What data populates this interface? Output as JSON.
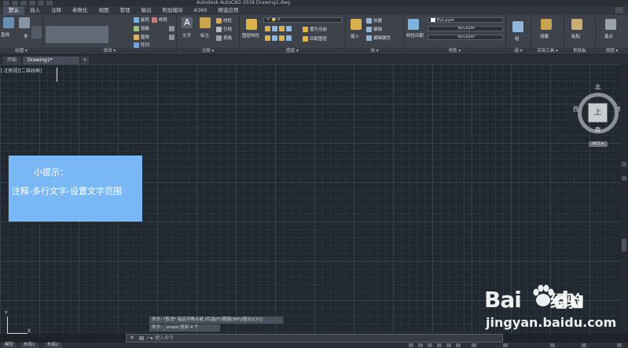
{
  "window": {
    "title": "Autodesk AutoCAD 2018   Drawing1.dwg"
  },
  "ribbon_tabs": [
    "默认",
    "插入",
    "注释",
    "参数化",
    "视图",
    "管理",
    "输出",
    "附加模块",
    "A360",
    "精选应用"
  ],
  "ribbon": {
    "draw": {
      "line_label": "直线",
      "multi_label": "多",
      "footer": "绘图 ▾"
    },
    "modify": {
      "rotate": "旋转",
      "trim": "修剪",
      "mirror": "镜像",
      "fillet": "圆角",
      "array": "阵列",
      "footer": "修改 ▾"
    },
    "annotation": {
      "text": "文字",
      "dimension": "标注",
      "linear": "线性",
      "leader": "引线",
      "table": "表格",
      "footer": "注释 ▾"
    },
    "layers": {
      "layer_props": "图层特性",
      "layer_value": "0",
      "set_current": "置为当前",
      "match_layer": "匹配图层",
      "footer": "图层 ▾"
    },
    "block": {
      "insert": "插入",
      "create": "创建",
      "edit": "编辑",
      "edit_attr": "编辑属性",
      "footer": "块 ▾"
    },
    "properties": {
      "match": "特性匹配",
      "bylayer1": "ByLayer",
      "bylayer2": "ByLayer",
      "bylayer3": "ByLayer",
      "footer": "特性 ▾"
    },
    "groups": {
      "label": "组",
      "footer": "组 ▾"
    },
    "utilities": {
      "measure": "测量",
      "footer": "实用工具 ▾"
    },
    "clipboard": {
      "paste": "粘贴",
      "footer": "剪贴板"
    },
    "view": {
      "base": "基点",
      "footer": "视图 ▾"
    }
  },
  "file_tabs": {
    "start": "开始",
    "drawing": "Drawing1*",
    "plus": "+"
  },
  "viewport_label": "[-][俯视][二维线框]",
  "tip": {
    "title": "小提示：",
    "body": "注释-多行文字-设置文字范围"
  },
  "viewcube": {
    "north": "北",
    "south": "南",
    "east": "东",
    "west": "西",
    "face": "上",
    "wcs": "WCS ▾"
  },
  "ucs": {
    "x": "X",
    "y": "Y"
  },
  "command_history": [
    "命令: *取消* 指定对角点或 [栏选(F)/圈围(WP)/圈交(CP)]:",
    "命令: _.erase 找到 4 个"
  ],
  "command_line": {
    "close": "✕",
    "prompt": "⌐▸",
    "placeholder": "键入命令"
  },
  "layout_tabs": [
    "模型",
    "布局1",
    "布局2"
  ],
  "watermark": {
    "bai": "Bai",
    "du": "du",
    "cn": "经验",
    "url": "jingyan.baidu.com"
  }
}
